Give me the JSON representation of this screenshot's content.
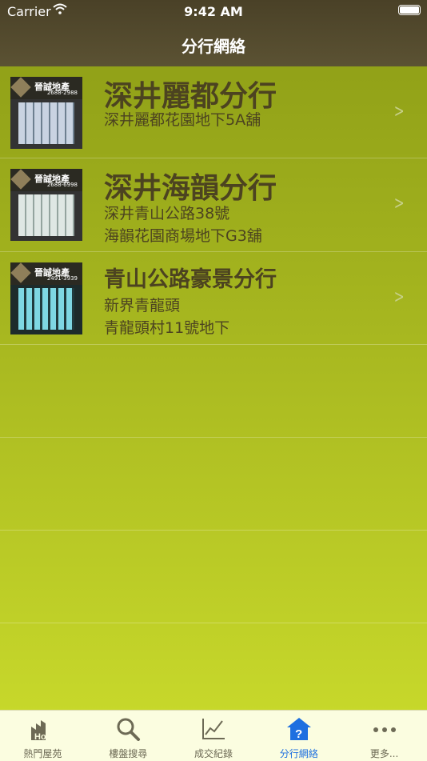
{
  "status_bar": {
    "carrier": "Carrier",
    "time": "9:42 AM"
  },
  "nav": {
    "title": "分行網絡"
  },
  "branches": [
    {
      "name": "深井麗都分行",
      "lines": [
        "深井麗都花園地下5A舖"
      ],
      "photo_label": "晉誠地產",
      "phone": "2688-2988"
    },
    {
      "name": "深井海韻分行",
      "lines": [
        "深井青山公路38號",
        "海韻花園商場地下G3舖"
      ],
      "photo_label": "晉誠地產",
      "phone": "2688-6998"
    },
    {
      "name": "青山公路豪景分行",
      "lines": [
        "新界青龍頭",
        "青龍頭村11號地下"
      ],
      "photo_label": "晉誠地產",
      "phone": "2491-3939"
    }
  ],
  "tabs": [
    {
      "label": "熱門屋苑",
      "icon": "hot-building-icon",
      "active": false
    },
    {
      "label": "樓盤搜尋",
      "icon": "search-icon",
      "active": false
    },
    {
      "label": "成交紀錄",
      "icon": "line-chart-icon",
      "active": false
    },
    {
      "label": "分行網絡",
      "icon": "question-house-icon",
      "active": true
    },
    {
      "label": "更多...",
      "icon": "more-dots-icon",
      "active": false
    }
  ],
  "colors": {
    "header": "#544b2c",
    "accent": "#1d6fe0",
    "text": "#4c4320"
  }
}
